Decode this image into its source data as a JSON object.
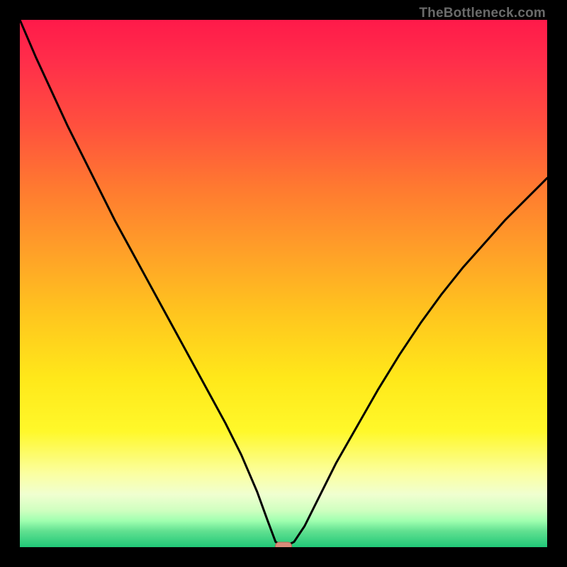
{
  "watermark": "TheBottleneck.com",
  "chart_data": {
    "type": "line",
    "title": "",
    "xlabel": "",
    "ylabel": "",
    "xlim": [
      0,
      100
    ],
    "ylim": [
      0,
      100
    ],
    "series": [
      {
        "name": "curve",
        "x": [
          0,
          3,
          6,
          9,
          12,
          15,
          18,
          21,
          24,
          27,
          30,
          33,
          36,
          39,
          42,
          45,
          47,
          48.5,
          50,
          52,
          54,
          57,
          60,
          64,
          68,
          72,
          76,
          80,
          84,
          88,
          92,
          96,
          100
        ],
        "values": [
          100,
          93,
          86.5,
          80,
          74,
          68,
          62,
          56.5,
          51,
          45.5,
          40,
          34.5,
          29,
          23.5,
          17.5,
          10.5,
          5,
          1,
          0,
          1,
          4,
          10,
          16,
          23,
          30,
          36.5,
          42.5,
          48,
          53,
          57.5,
          62,
          66,
          70
        ]
      }
    ],
    "marker": {
      "x": 50,
      "y": 0,
      "color": "#d98b7a"
    },
    "annotations": []
  }
}
